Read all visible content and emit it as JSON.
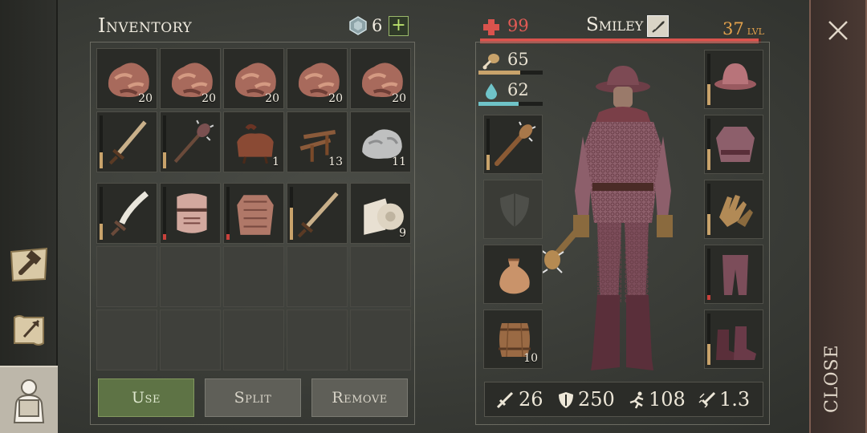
{
  "inventory": {
    "title": "Inventory",
    "currency_count": "6",
    "plus_label": "+",
    "slots_top": [
      {
        "name": "copper-ore",
        "count": "20"
      },
      {
        "name": "copper-ore",
        "count": "20"
      },
      {
        "name": "copper-ore",
        "count": "20"
      },
      {
        "name": "copper-ore",
        "count": "20"
      },
      {
        "name": "copper-ore",
        "count": "20"
      },
      {
        "name": "sword",
        "count": "",
        "durability": 0.3
      },
      {
        "name": "spiked-mace",
        "count": "",
        "durability": 0.3
      },
      {
        "name": "saddle",
        "count": "1"
      },
      {
        "name": "wooden-stakes",
        "count": "13"
      },
      {
        "name": "stone",
        "count": "11"
      }
    ],
    "slots_bottom": [
      {
        "name": "falchion",
        "count": "",
        "durability": 0.3
      },
      {
        "name": "great-helm",
        "count": "",
        "durability": 0.1
      },
      {
        "name": "gambeson",
        "count": "",
        "durability": 0.1
      },
      {
        "name": "long-sword",
        "count": "",
        "durability": 0.6
      },
      {
        "name": "cloth-roll",
        "count": "9"
      }
    ],
    "buttons": {
      "use": "Use",
      "split": "Split",
      "remove": "Remove"
    }
  },
  "character": {
    "name": "Smiley",
    "health": "99",
    "level": "37",
    "level_suffix": "lvl",
    "food": "65",
    "water": "62",
    "stats": {
      "attack": "26",
      "armor": "250",
      "speed": "108",
      "attack_speed": "1.3"
    },
    "left_slots": [
      {
        "name": "spiked-club",
        "count": "",
        "durability": 0.3
      },
      {
        "name": "shield-placeholder",
        "count": ""
      },
      {
        "name": "sack",
        "count": ""
      },
      {
        "name": "barrel",
        "count": "10"
      }
    ],
    "right_slots": [
      {
        "name": "kettle-hat",
        "durability": 0.4
      },
      {
        "name": "chainmail-shirt",
        "durability": 0.4
      },
      {
        "name": "leather-gloves",
        "durability": 0.4
      },
      {
        "name": "chainmail-leggings",
        "durability": 0.1
      },
      {
        "name": "boots",
        "durability": 0.4
      }
    ]
  },
  "close": {
    "label": "CLOSE"
  },
  "colors": {
    "health": "#d9534d",
    "level": "#e2a14c",
    "food_bar": "#c9a36b",
    "water_bar": "#6fc3c8",
    "accent_green": "#5e7345",
    "durability": "#c9a36b",
    "durability_low": "#c9413b"
  }
}
